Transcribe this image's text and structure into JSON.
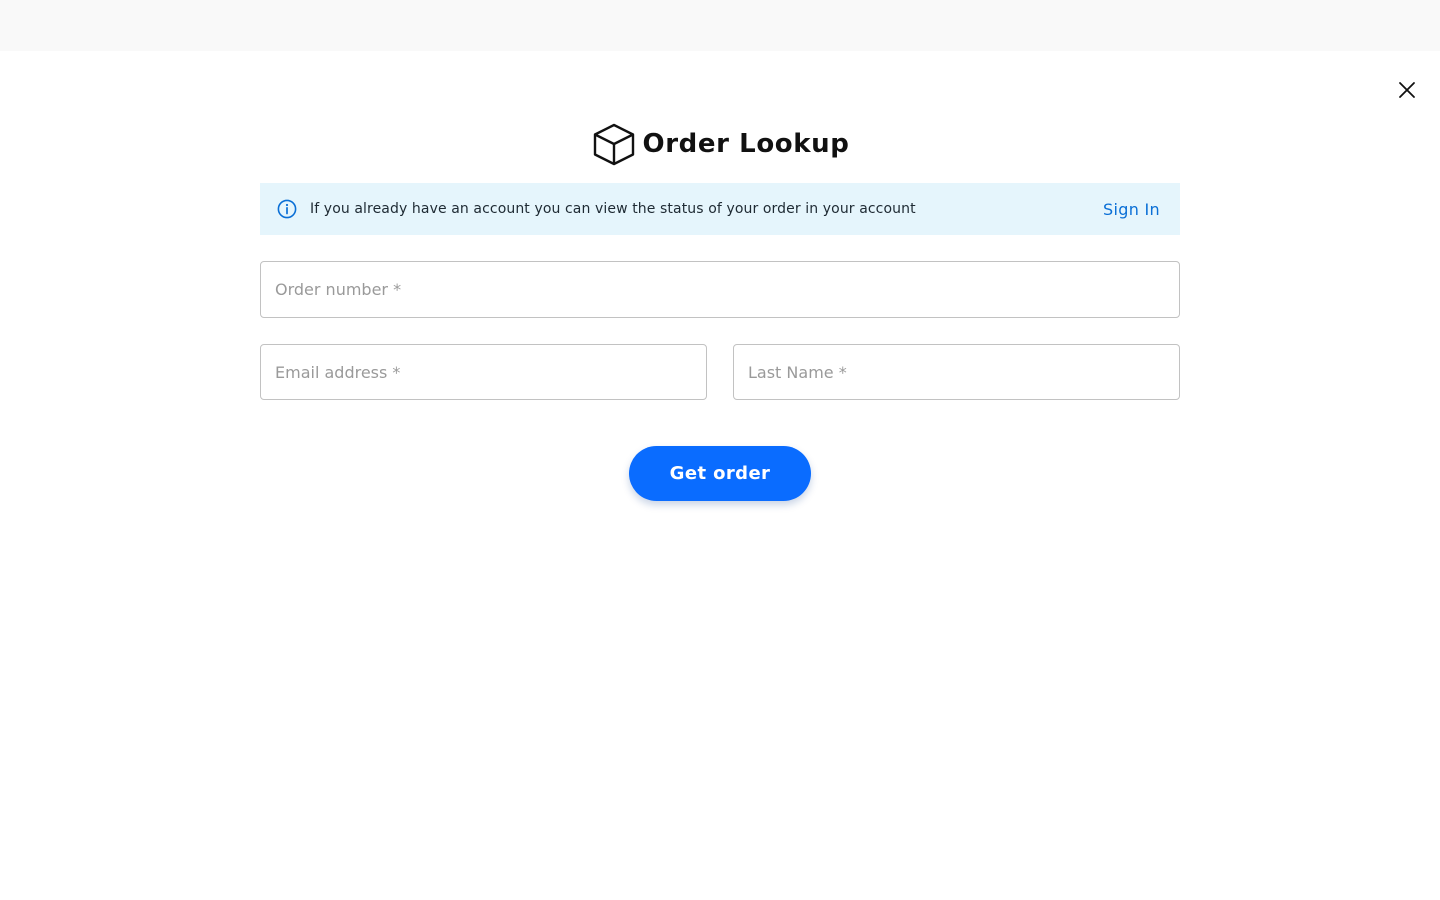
{
  "modal": {
    "title": "Order Lookup",
    "close_icon": "close-icon",
    "title_icon": "box-icon"
  },
  "info_banner": {
    "icon": "info-icon",
    "message": "If you already have an account you can view the status of your order in your account",
    "sign_in_label": "Sign In",
    "accent_color": "#0a6fd6",
    "background_color": "#e5f5fc"
  },
  "form": {
    "order_number": {
      "value": "",
      "placeholder": "Order number *"
    },
    "email": {
      "value": "",
      "placeholder": "Email address *"
    },
    "last_name": {
      "value": "",
      "placeholder": "Last Name *"
    },
    "submit_label": "Get order",
    "submit_color": "#0a6cff"
  }
}
